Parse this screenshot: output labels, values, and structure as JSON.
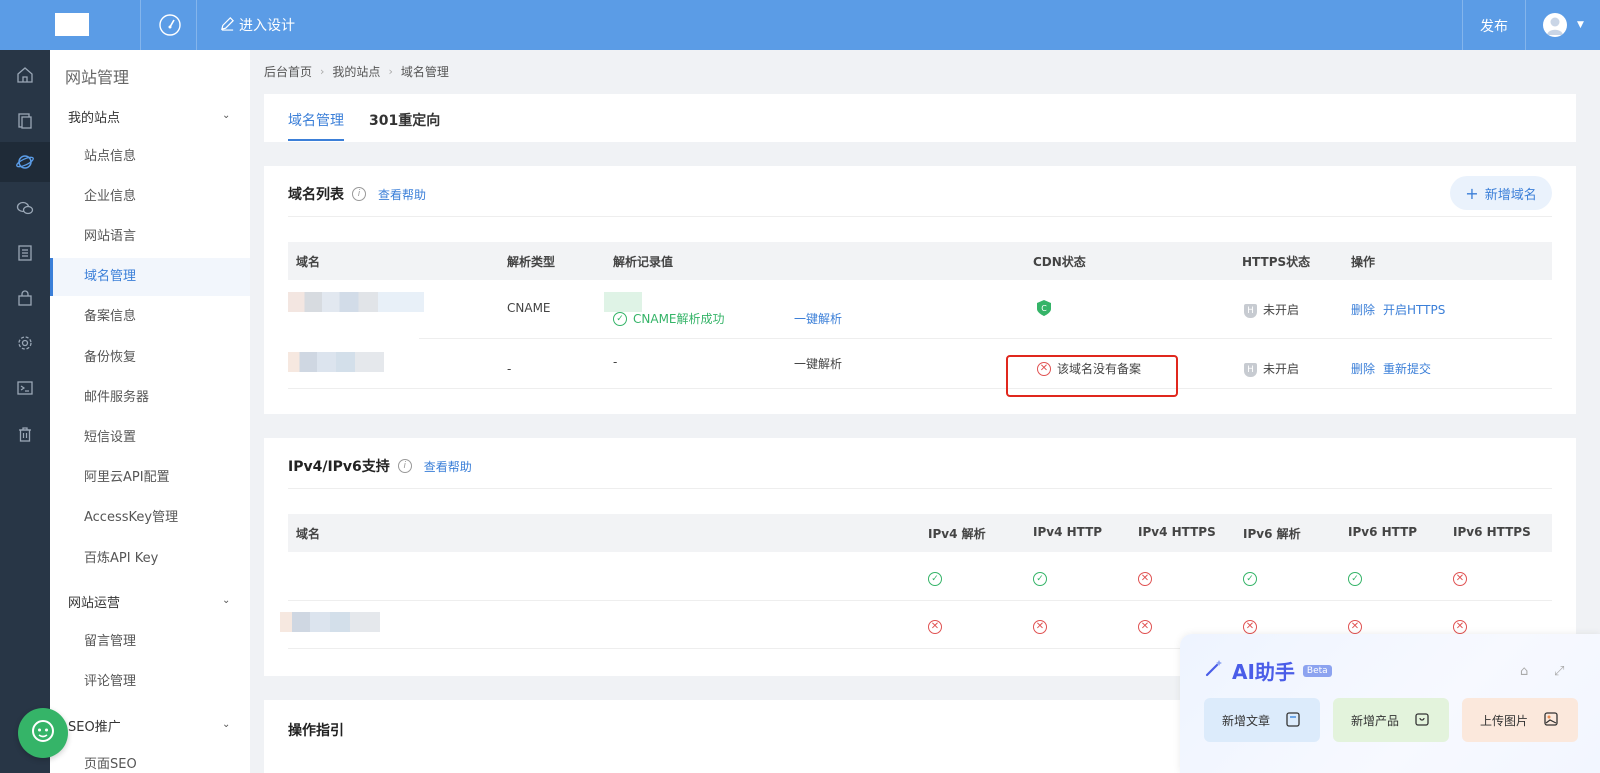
{
  "topbar": {
    "design_label": "进入设计",
    "publish_label": "发布"
  },
  "sidebar": {
    "title": "网站管理",
    "groups": [
      {
        "label": "我的站点"
      },
      {
        "label": "网站运营"
      },
      {
        "label": "SEO推广"
      }
    ],
    "items": [
      {
        "label": "站点信息"
      },
      {
        "label": "企业信息"
      },
      {
        "label": "网站语言"
      },
      {
        "label": "域名管理"
      },
      {
        "label": "备案信息"
      },
      {
        "label": "备份恢复"
      },
      {
        "label": "邮件服务器"
      },
      {
        "label": "短信设置"
      },
      {
        "label": "阿里云API配置"
      },
      {
        "label": "AccessKey管理"
      },
      {
        "label": "百炼API Key"
      },
      {
        "label": "留言管理"
      },
      {
        "label": "评论管理"
      },
      {
        "label": "页面SEO"
      }
    ]
  },
  "breadcrumb": [
    "后台首页",
    "我的站点",
    "域名管理"
  ],
  "tabs": [
    {
      "label": "域名管理"
    },
    {
      "label": "301重定向"
    }
  ],
  "domain_list": {
    "title": "域名列表",
    "help": "查看帮助",
    "add_button": "新增域名",
    "columns": [
      "域名",
      "解析类型",
      "解析记录值",
      "CDN状态",
      "HTTPS状态",
      "操作"
    ],
    "rows": [
      {
        "type": "CNAME",
        "status": "CNAME解析成功",
        "action_resolve": "一键解析",
        "https": "未开启",
        "action1": "删除",
        "action2": "开启HTTPS"
      },
      {
        "type": "-",
        "record": "-",
        "action_resolve": "一键解析",
        "cdn": "该域名没有备案",
        "https": "未开启",
        "action1": "删除",
        "action2": "重新提交"
      }
    ]
  },
  "ip_support": {
    "title": "IPv4/IPv6支持",
    "help": "查看帮助",
    "columns": [
      "域名",
      "IPv4 解析",
      "IPv4 HTTP",
      "IPv4 HTTPS",
      "IPv6 解析",
      "IPv6 HTTP",
      "IPv6 HTTPS"
    ],
    "rows": [
      {
        "status": [
          "ok",
          "ok",
          "fail",
          "ok",
          "ok",
          "fail"
        ]
      },
      {
        "status": [
          "fail",
          "fail",
          "fail",
          "fail",
          "fail",
          "fail"
        ]
      }
    ]
  },
  "guide": {
    "title": "操作指引"
  },
  "ai_assistant": {
    "title": "AI助手",
    "badge": "Beta",
    "buttons": [
      {
        "label": "新增文章",
        "color": "#dcebfb"
      },
      {
        "label": "新增产品",
        "color": "#e3f3dc"
      },
      {
        "label": "上传图片",
        "color": "#fbe8dc"
      }
    ]
  },
  "colors": {
    "topbar": "#5b9ce6",
    "rail": "#283646",
    "accent": "#3b7fd8",
    "success": "#35b468",
    "danger": "#e05252"
  }
}
